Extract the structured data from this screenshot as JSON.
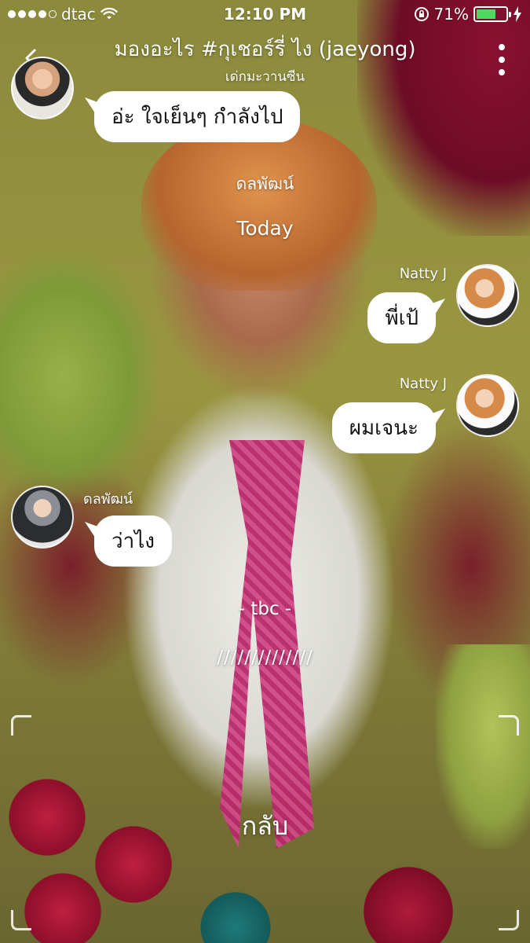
{
  "status_bar": {
    "carrier": "dtac",
    "time": "12:10 PM",
    "battery": "71%",
    "battery_level": 0.71,
    "battery_color": "#4cd964"
  },
  "header": {
    "title": "มองอะไร #กุเชอร์รี่ ไง (jaeyong)",
    "subtitle": "เด่กมะวานซีน",
    "back_icon": "chevron-left-icon",
    "more_icon": "more-vertical-icon"
  },
  "messages": {
    "m0": {
      "text": "อ่ะ ใจเย็นๆ กำลังไป"
    },
    "sys_sender": "ดลพัฒน์",
    "date_label": "Today",
    "m1": {
      "sender": "Natty J",
      "text": "พี่เป้"
    },
    "m2": {
      "sender": "Natty J",
      "text": "ผมเจนะ"
    },
    "m3": {
      "sender": "ดลพัฒน์",
      "text": "ว่าไง"
    },
    "tbc": "- tbc -",
    "divider": "//////////////"
  },
  "footer": {
    "back_label": "กลับ"
  }
}
